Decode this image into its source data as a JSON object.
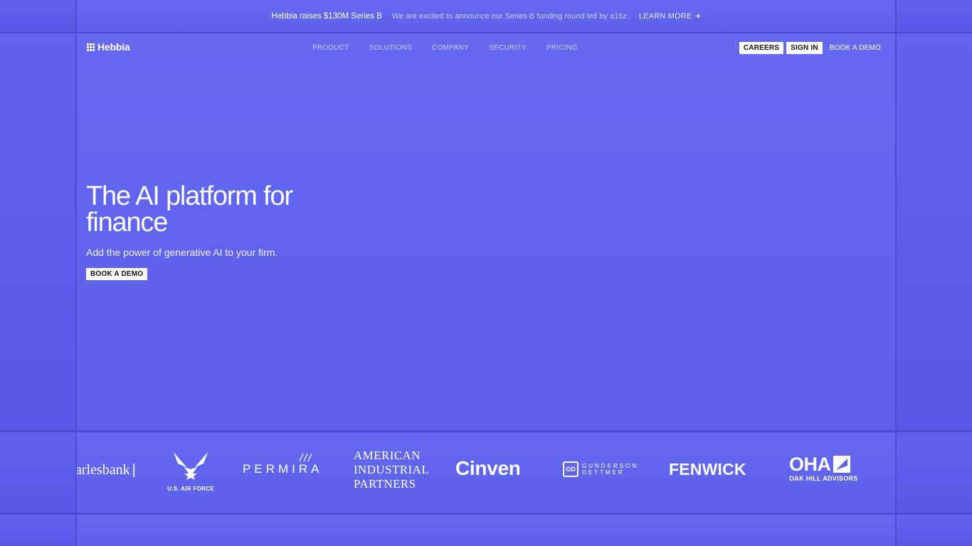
{
  "announcement": {
    "headline": "Hebbia raises $130M Series B",
    "description": "We are excited to announce our Series B funding round led by a16z.",
    "link_label": "LEARN MORE",
    "link_icon": "arrow-right-icon"
  },
  "nav": {
    "brand": "Hebbia",
    "links": [
      "PRODUCT",
      "SOLUTIONS",
      "COMPANY",
      "SECURITY",
      "PRICING"
    ],
    "careers": "CAREERS",
    "sign_in": "SIGN IN",
    "book_demo": "BOOK A DEMO"
  },
  "hero": {
    "title_line1": "The AI platform for",
    "title_line2": "finance",
    "subtitle": "Add the power of generative AI to your firm.",
    "cta": "BOOK A DEMO"
  },
  "customers": {
    "charlesbank": "arlesbank",
    "air_force": "U.S. AIR FORCE",
    "permira": "PERMIRA",
    "aip": [
      "AMERICAN",
      "INDUSTRIAL",
      "PARTNERS"
    ],
    "cinven": "Cinven",
    "gd_mark": "GD",
    "gd_words": [
      "GUNDERSON",
      "DETTMER"
    ],
    "fenwick": "FENWICK",
    "oha": "OHA",
    "oha_sub": "OAK HILL ADVISORS"
  },
  "colors": {
    "background": "#5a60ea",
    "button": "#ffffff",
    "muted_text": "#c7c9fb"
  }
}
